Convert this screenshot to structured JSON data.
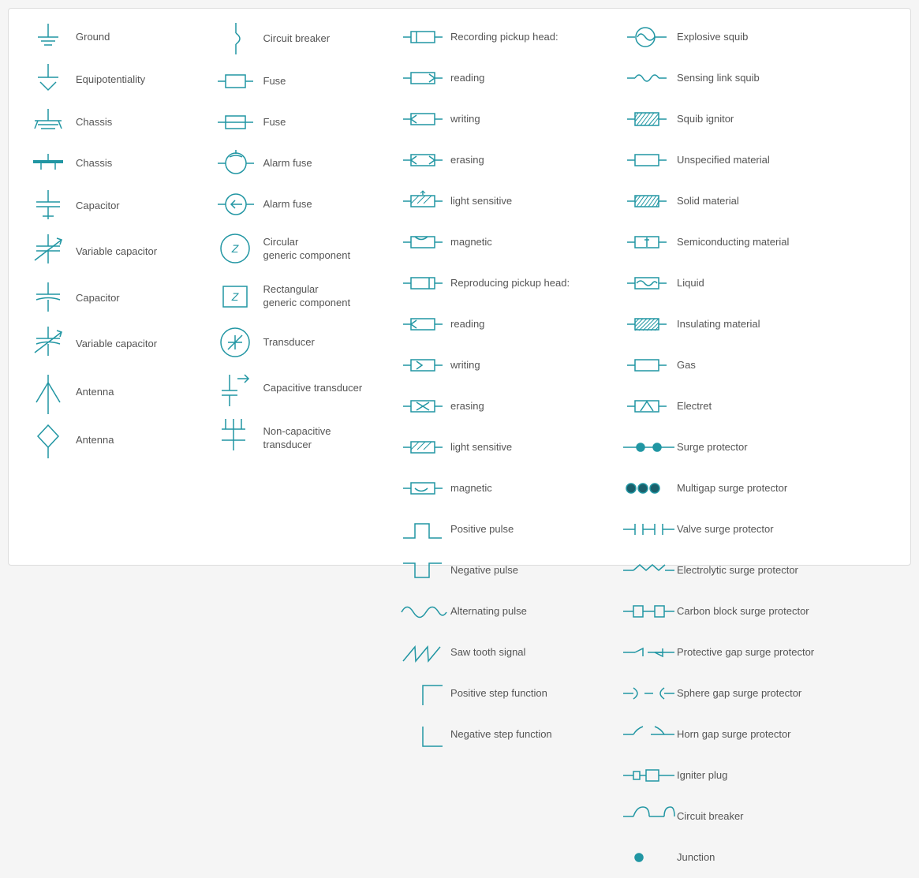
{
  "col1": [
    {
      "symbol": "ground",
      "label": "Ground"
    },
    {
      "symbol": "equipotentiality",
      "label": "Equipotentiality"
    },
    {
      "symbol": "chassis1",
      "label": "Chassis"
    },
    {
      "symbol": "chassis2",
      "label": "Chassis"
    },
    {
      "symbol": "capacitor1",
      "label": "Capacitor"
    },
    {
      "symbol": "variable-capacitor1",
      "label": "Variable capacitor"
    },
    {
      "symbol": "capacitor2",
      "label": "Capacitor"
    },
    {
      "symbol": "variable-capacitor2",
      "label": "Variable capacitor"
    },
    {
      "symbol": "antenna1",
      "label": "Antenna"
    },
    {
      "symbol": "antenna2",
      "label": "Antenna"
    }
  ],
  "col2": [
    {
      "symbol": "circuit-breaker",
      "label": "Circuit breaker"
    },
    {
      "symbol": "fuse1",
      "label": "Fuse"
    },
    {
      "symbol": "fuse2",
      "label": "Fuse"
    },
    {
      "symbol": "alarm-fuse1",
      "label": "Alarm fuse"
    },
    {
      "symbol": "alarm-fuse2",
      "label": "Alarm fuse"
    },
    {
      "symbol": "circular-generic",
      "label": "Circular\ngeneric component"
    },
    {
      "symbol": "rectangular-generic",
      "label": "Rectangular\ngeneric component"
    },
    {
      "symbol": "transducer",
      "label": "Transducer"
    },
    {
      "symbol": "capacitive-transducer",
      "label": "Capacitive transducer"
    },
    {
      "symbol": "non-capacitive-transducer",
      "label": "Non-capacitive\ntransducer"
    }
  ],
  "col3": [
    {
      "symbol": "recording-reading",
      "label": "Recording pickup head:"
    },
    {
      "symbol": "rec-reading",
      "label": "reading"
    },
    {
      "symbol": "rec-writing",
      "label": "writing"
    },
    {
      "symbol": "rec-erasing",
      "label": "erasing"
    },
    {
      "symbol": "rec-light",
      "label": "light sensitive"
    },
    {
      "symbol": "rec-magnetic",
      "label": "magnetic"
    },
    {
      "symbol": "reproducing-head",
      "label": "Reproducing pickup head:"
    },
    {
      "symbol": "rep-reading",
      "label": "reading"
    },
    {
      "symbol": "rep-writing",
      "label": "writing"
    },
    {
      "symbol": "rep-erasing",
      "label": "erasing"
    },
    {
      "symbol": "rep-light",
      "label": "light sensitive"
    },
    {
      "symbol": "rep-magnetic",
      "label": "magnetic"
    },
    {
      "symbol": "positive-pulse",
      "label": "Positive pulse"
    },
    {
      "symbol": "negative-pulse",
      "label": "Negative pulse"
    },
    {
      "symbol": "alternating-pulse",
      "label": "Alternating pulse"
    },
    {
      "symbol": "saw-tooth",
      "label": "Saw tooth signal"
    },
    {
      "symbol": "positive-step",
      "label": "Positive step function"
    },
    {
      "symbol": "negative-step",
      "label": "Negative step function"
    }
  ],
  "col4": [
    {
      "symbol": "explosive-squib",
      "label": "Explosive squib"
    },
    {
      "symbol": "sensing-link-squib",
      "label": "Sensing link squib"
    },
    {
      "symbol": "squib-ignitor",
      "label": "Squib ignitor"
    },
    {
      "symbol": "unspecified-material",
      "label": "Unspecified material"
    },
    {
      "symbol": "solid-material",
      "label": "Solid material"
    },
    {
      "symbol": "semiconducting-material",
      "label": "Semiconducting material"
    },
    {
      "symbol": "liquid",
      "label": "Liquid"
    },
    {
      "symbol": "insulating-material",
      "label": "Insulating material"
    },
    {
      "symbol": "gas",
      "label": "Gas"
    },
    {
      "symbol": "electret",
      "label": "Electret"
    },
    {
      "symbol": "surge-protector",
      "label": "Surge protector"
    },
    {
      "symbol": "multigap-surge",
      "label": "Multigap surge protector"
    },
    {
      "symbol": "valve-surge",
      "label": "Valve surge protector"
    },
    {
      "symbol": "electrolytic-surge",
      "label": "Electrolytic surge protector"
    },
    {
      "symbol": "carbon-block-surge",
      "label": "Carbon block surge protector"
    },
    {
      "symbol": "protective-gap-surge",
      "label": "Protective gap surge protector"
    },
    {
      "symbol": "sphere-gap-surge",
      "label": "Sphere gap surge protector"
    },
    {
      "symbol": "horn-gap-surge",
      "label": "Horn gap surge protector"
    },
    {
      "symbol": "igniter-plug",
      "label": "Igniter plug"
    },
    {
      "symbol": "circuit-breaker2",
      "label": "Circuit breaker"
    },
    {
      "symbol": "junction",
      "label": "Junction"
    }
  ]
}
